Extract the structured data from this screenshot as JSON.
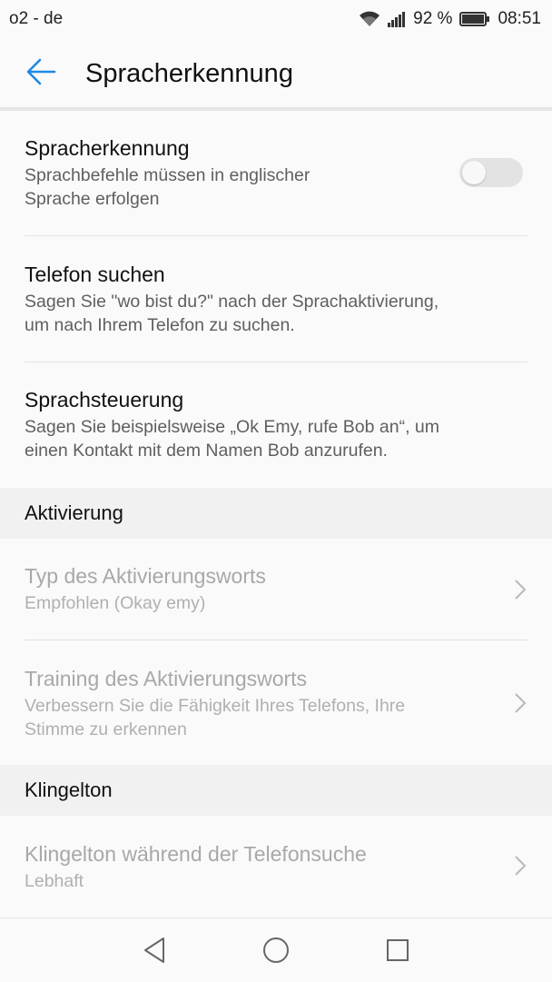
{
  "status_bar": {
    "carrier": "o2 - de",
    "battery_percent": "92 %",
    "time": "08:51",
    "icons": [
      "wifi-icon",
      "signal-icon",
      "battery-icon"
    ]
  },
  "app_bar": {
    "title": "Spracherkennung",
    "back_icon": "back-arrow-icon",
    "accent_color": "#1e88e5"
  },
  "settings": {
    "voice_recognition": {
      "title": "Spracherkennung",
      "subtitle_line1": "Sprachbefehle müssen in englischer",
      "subtitle_line2": "Sprache erfolgen",
      "toggle_on": false
    },
    "find_phone": {
      "title": "Telefon suchen",
      "subtitle_line1": "Sagen Sie \"wo bist du?\" nach der Sprachaktivierung,",
      "subtitle_line2": "um nach Ihrem Telefon zu suchen."
    },
    "voice_control": {
      "title": "Sprachsteuerung",
      "subtitle_line1": "Sagen Sie beispielsweise „Ok Emy, rufe Bob an“, um",
      "subtitle_line2": "einen Kontakt mit dem Namen Bob anzurufen."
    }
  },
  "activation": {
    "header": "Aktivierung",
    "wake_word_type": {
      "title": "Typ des Aktivierungsworts",
      "subtitle": "Empfohlen (Okay emy)"
    },
    "wake_word_training": {
      "title": "Training des Aktivierungsworts",
      "subtitle_line1": "Verbessern Sie die Fähigkeit Ihres Telefons, Ihre",
      "subtitle_line2": "Stimme zu erkennen"
    }
  },
  "ringtone": {
    "header": "Klingelton",
    "search_ringtone": {
      "title": "Klingelton während der Telefonsuche",
      "subtitle": "Lebhaft"
    }
  },
  "nav_bar": {
    "buttons": [
      "back-triangle-icon",
      "home-circle-icon",
      "recents-square-icon"
    ]
  }
}
